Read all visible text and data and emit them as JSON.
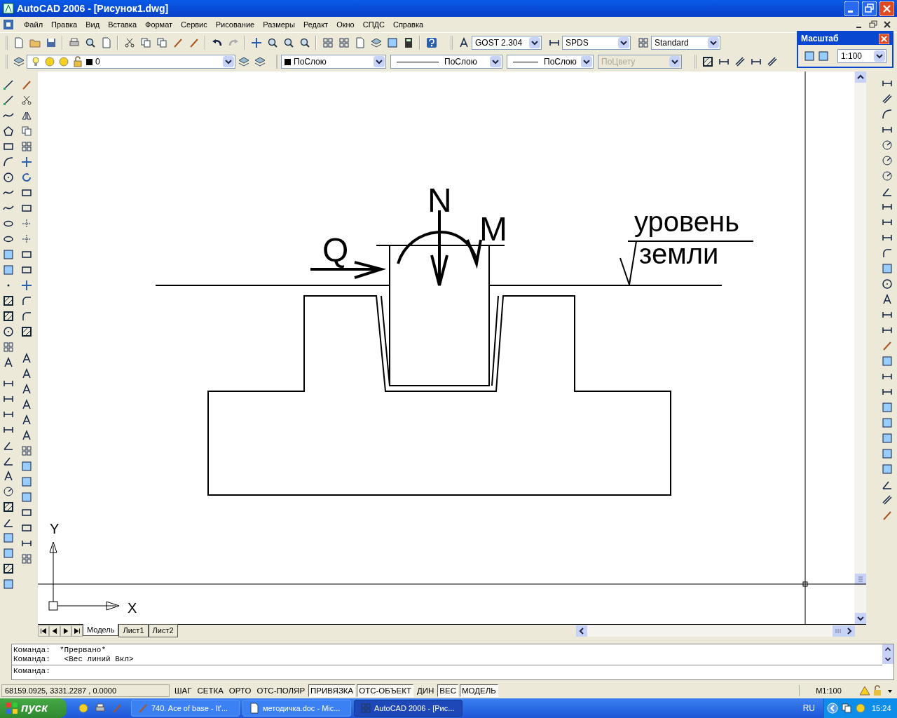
{
  "window": {
    "title": "AutoCAD 2006 - [Рисунок1.dwg]"
  },
  "menu": [
    "Файл",
    "Правка",
    "Вид",
    "Вставка",
    "Формат",
    "Сервис",
    "Рисование",
    "Размеры",
    "Редакт",
    "Окно",
    "СПДС",
    "Справка"
  ],
  "toolbars": {
    "text_style": "GOST 2.304",
    "dim_style": "SPDS",
    "table_style": "Standard",
    "layer": "0",
    "object_color": "ПоСлою",
    "linetype": "ПоСлою",
    "lineweight": "ПоСлою",
    "plot_style": {
      "value": "ПоЦвету",
      "disabled": true
    }
  },
  "scale_toolbar": {
    "title": "Масштаб",
    "scale": "1:100"
  },
  "drawing": {
    "labels": [
      {
        "kind": "shear",
        "text": "Q"
      },
      {
        "kind": "normal",
        "text": "N"
      },
      {
        "kind": "moment",
        "text": "M"
      },
      {
        "kind": "ground_top",
        "text": "уровень"
      },
      {
        "kind": "ground_bottom",
        "text": "земли"
      }
    ],
    "ucs": {
      "x": "X",
      "y": "Y"
    }
  },
  "layout_tabs": [
    {
      "label": "Модель",
      "selected": true
    },
    {
      "label": "Лист1",
      "selected": false
    },
    {
      "label": "Лист2",
      "selected": false
    }
  ],
  "command_history": [
    "Команда:  *Прервано*",
    "Команда:   <Вес линий Вкл>"
  ],
  "command_prompt": "Команда:",
  "status_bar": {
    "coordinates": "68159.0925, 3331.2287 , 0.0000",
    "toggles": [
      {
        "label": "ШАГ",
        "on": false
      },
      {
        "label": "СЕТКА",
        "on": false
      },
      {
        "label": "ОРТО",
        "on": false
      },
      {
        "label": "ОТС-ПОЛЯР",
        "on": false
      },
      {
        "label": "ПРИВЯЗКА",
        "on": true
      },
      {
        "label": "ОТС-ОБЪЕКТ",
        "on": true
      },
      {
        "label": "ДИН",
        "on": false
      },
      {
        "label": "ВЕС",
        "on": true
      },
      {
        "label": "МОДЕЛЬ",
        "on": true
      }
    ],
    "scale": "M1:100"
  },
  "taskbar": {
    "start": "пуск",
    "tasks": [
      {
        "label": "740. Ace of base - It'...",
        "selected": false
      },
      {
        "label": "методичка.doc - Mic...",
        "selected": false
      },
      {
        "label": "AutoCAD 2006 - [Рис...",
        "selected": true
      }
    ],
    "language": "RU",
    "clock": "15:24"
  }
}
